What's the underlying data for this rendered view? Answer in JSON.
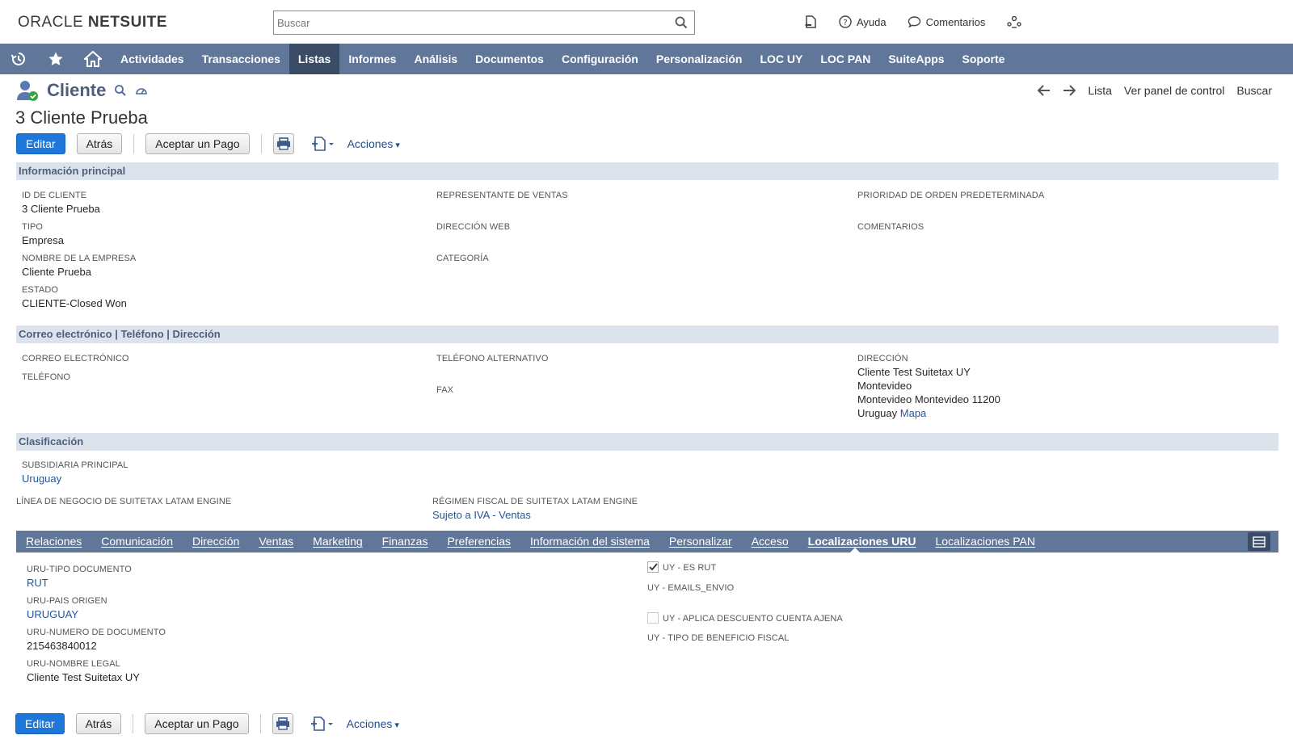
{
  "header": {
    "logo_oracle": "ORACLE",
    "logo_netsuite": "NETSUITE",
    "search_placeholder": "Buscar",
    "help_label": "Ayuda",
    "comments_label": "Comentarios"
  },
  "nav": {
    "items": [
      "Actividades",
      "Transacciones",
      "Listas",
      "Informes",
      "Análisis",
      "Documentos",
      "Configuración",
      "Personalización",
      "LOC UY",
      "LOC PAN",
      "SuiteApps",
      "Soporte"
    ],
    "active": "Listas"
  },
  "record": {
    "type_label": "Cliente",
    "name": "3 Cliente Prueba",
    "right_nav": {
      "list": "Lista",
      "dashboard": "Ver panel de control",
      "search": "Buscar"
    }
  },
  "buttons": {
    "edit": "Editar",
    "back": "Atrás",
    "accept_payment": "Aceptar un Pago",
    "actions": "Acciones"
  },
  "sections": {
    "main": "Información principal",
    "contact": "Correo electrónico | Teléfono | Dirección",
    "classification": "Clasificación"
  },
  "main_fields": {
    "customer_id_label": "ID DE CLIENTE",
    "customer_id": "3 Cliente Prueba",
    "type_label": "TIPO",
    "type": "Empresa",
    "company_label": "NOMBRE DE LA EMPRESA",
    "company": "Cliente Prueba",
    "status_label": "ESTADO",
    "status": "CLIENTE-Closed Won",
    "sales_rep_label": "REPRESENTANTE DE VENTAS",
    "web_label": "DIRECCIÓN WEB",
    "category_label": "CATEGORÍA",
    "priority_label": "PRIORIDAD DE ORDEN PREDETERMINADA",
    "comments_label": "COMENTARIOS"
  },
  "contact_fields": {
    "email_label": "CORREO ELECTRÓNICO",
    "phone_label": "TELÉFONO",
    "alt_phone_label": "TELÉFONO ALTERNATIVO",
    "fax_label": "FAX",
    "address_label": "DIRECCIÓN",
    "address_line1": "Cliente Test Suitetax UY",
    "address_line2": "Montevideo",
    "address_line3": "Montevideo Montevideo 11200",
    "address_country": "Uruguay",
    "address_map": "Mapa"
  },
  "classification_fields": {
    "subsidiary_label": "SUBSIDIARIA PRINCIPAL",
    "subsidiary": "Uruguay",
    "business_line_label": "LÍNEA DE NEGOCIO DE SUITETAX LATAM ENGINE",
    "tax_regime_label": "RÉGIMEN FISCAL DE SUITETAX LATAM ENGINE",
    "tax_regime": "Sujeto a IVA - Ventas"
  },
  "subtabs": {
    "items": [
      "Relaciones",
      "Comunicación",
      "Dirección",
      "Ventas",
      "Marketing",
      "Finanzas",
      "Preferencias",
      "Información del sistema",
      "Personalizar",
      "Acceso",
      "Localizaciones URU",
      "Localizaciones PAN"
    ],
    "active": "Localizaciones URU"
  },
  "uru_fields": {
    "doc_type_label": "URU-TIPO DOCUMENTO",
    "doc_type": "RUT",
    "country_label": "URU-PAIS ORIGEN",
    "country": "URUGUAY",
    "doc_number_label": "URU-NUMERO DE DOCUMENTO",
    "doc_number": "215463840012",
    "legal_name_label": "URU-NOMBRE LEGAL",
    "legal_name": "Cliente Test Suitetax UY",
    "es_rut_label": "UY - ES RUT",
    "es_rut_checked": true,
    "emails_label": "UY - EMAILS_ENVIO",
    "discount_label": "UY - APLICA DESCUENTO CUENTA AJENA",
    "discount_checked": false,
    "benefit_label": "UY - TIPO DE BENEFICIO FISCAL"
  }
}
